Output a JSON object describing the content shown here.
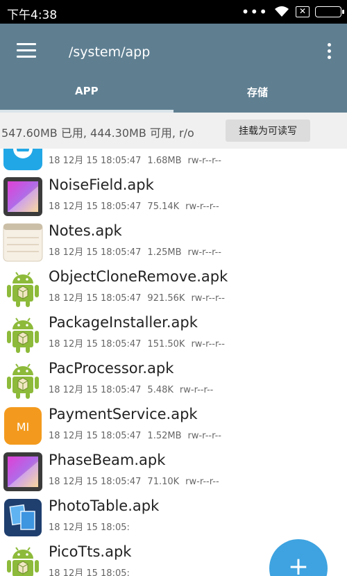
{
  "status_bar": {
    "time": "下午4:38",
    "signal_dots": "•••"
  },
  "app_bar": {
    "title": "/system/app",
    "tabs": [
      {
        "label": "APP",
        "selected": true
      },
      {
        "label": "存储",
        "selected": false
      }
    ]
  },
  "storage": {
    "info": "547.60MB 已用, 444.30MB 可用, r/o",
    "mount_button": "挂载为可读写"
  },
  "files": [
    {
      "name": "",
      "date": "18 12月 15 18:05:47",
      "size": "1.68MB",
      "perms": "rw-r--r--",
      "icon": "blue-app-icon"
    },
    {
      "name": "NoiseField.apk",
      "date": "18 12月 15 18:05:47",
      "size": "75.14K",
      "perms": "rw-r--r--",
      "icon": "wallpaper-icon"
    },
    {
      "name": "Notes.apk",
      "date": "18 12月 15 18:05:47",
      "size": "1.25MB",
      "perms": "rw-r--r--",
      "icon": "notes-icon"
    },
    {
      "name": "ObjectCloneRemove.apk",
      "date": "18 12月 15 18:05:47",
      "size": "921.56K",
      "perms": "rw-r--r--",
      "icon": "android-icon"
    },
    {
      "name": "PackageInstaller.apk",
      "date": "18 12月 15 18:05:47",
      "size": "151.50K",
      "perms": "rw-r--r--",
      "icon": "android-icon"
    },
    {
      "name": "PacProcessor.apk",
      "date": "18 12月 15 18:05:47",
      "size": "5.48K",
      "perms": "rw-r--r--",
      "icon": "android-icon"
    },
    {
      "name": "PaymentService.apk",
      "date": "18 12月 15 18:05:47",
      "size": "1.52MB",
      "perms": "rw-r--r--",
      "icon": "mi-icon",
      "icon_text": "MI"
    },
    {
      "name": "PhaseBeam.apk",
      "date": "18 12月 15 18:05:47",
      "size": "71.10K",
      "perms": "rw-r--r--",
      "icon": "wallpaper-icon"
    },
    {
      "name": "PhotoTable.apk",
      "date": "18 12月 15 18:05:",
      "size": "",
      "perms": "",
      "icon": "photo-table-icon"
    },
    {
      "name": "PicoTts.apk",
      "date": "18 12月 15 18:05:",
      "size": "",
      "perms": "",
      "icon": "android-icon"
    }
  ],
  "fab": {
    "label": "+"
  },
  "colors": {
    "app_bar": "#5f7f91",
    "accent": "#3ea3e0",
    "android_green": "#8dba3a",
    "mi_orange": "#f39a1e"
  }
}
